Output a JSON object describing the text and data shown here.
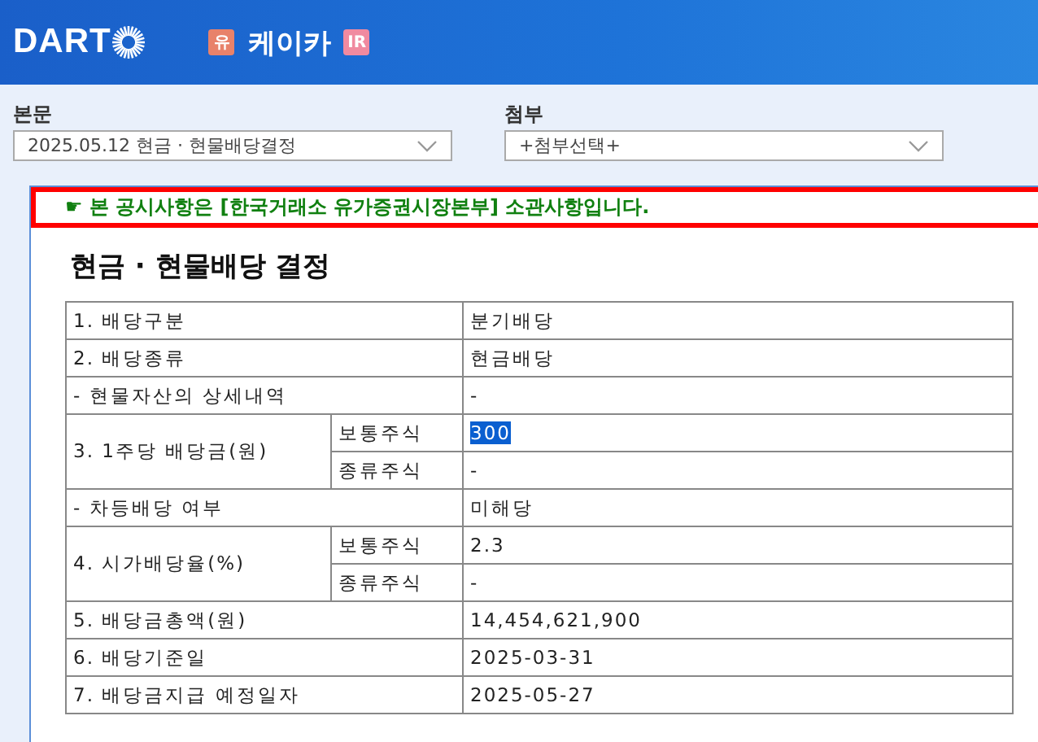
{
  "header": {
    "logo_text": "DART",
    "company_badge": "유",
    "company": "케이카",
    "ir_badge": "IR"
  },
  "selectors": [
    {
      "label": "본문",
      "value": "2025.05.12  현금 · 현물배당결정"
    },
    {
      "label": "첨부",
      "value": "+첨부선택+"
    }
  ],
  "notice": {
    "icon": "☛",
    "text": "본 공시사항은 [한국거래소 유가증권시장본부] 소관사항입니다."
  },
  "document": {
    "title": "현금 · 현물배당 결정",
    "rows": [
      {
        "kind": "single",
        "label": "1. 배당구분",
        "value": "분기배당",
        "selected": false
      },
      {
        "kind": "single",
        "label": "2. 배당종류",
        "value": "현금배당",
        "selected": false
      },
      {
        "kind": "single",
        "label": "- 현물자산의 상세내역",
        "value": "-",
        "selected": false
      },
      {
        "kind": "split",
        "label": "3. 1주당 배당금(원)",
        "parts": [
          {
            "label": "보통주식",
            "value": "300",
            "selected": true
          },
          {
            "label": "종류주식",
            "value": "-",
            "selected": false
          }
        ]
      },
      {
        "kind": "single",
        "label": "- 차등배당 여부",
        "value": "미해당",
        "selected": false
      },
      {
        "kind": "split",
        "label": "4. 시가배당율(%)",
        "parts": [
          {
            "label": "보통주식",
            "value": "2.3",
            "selected": false
          },
          {
            "label": "종류주식",
            "value": "-",
            "selected": false
          }
        ]
      },
      {
        "kind": "single",
        "label": "5. 배당금총액(원)",
        "value": "14,454,621,900",
        "selected": false
      },
      {
        "kind": "single",
        "label": "6. 배당기준일",
        "value": "2025-03-31",
        "selected": false
      },
      {
        "kind": "single",
        "label": "7. 배당금지급 예정일자",
        "value": "2025-05-27",
        "selected": false
      }
    ]
  }
}
